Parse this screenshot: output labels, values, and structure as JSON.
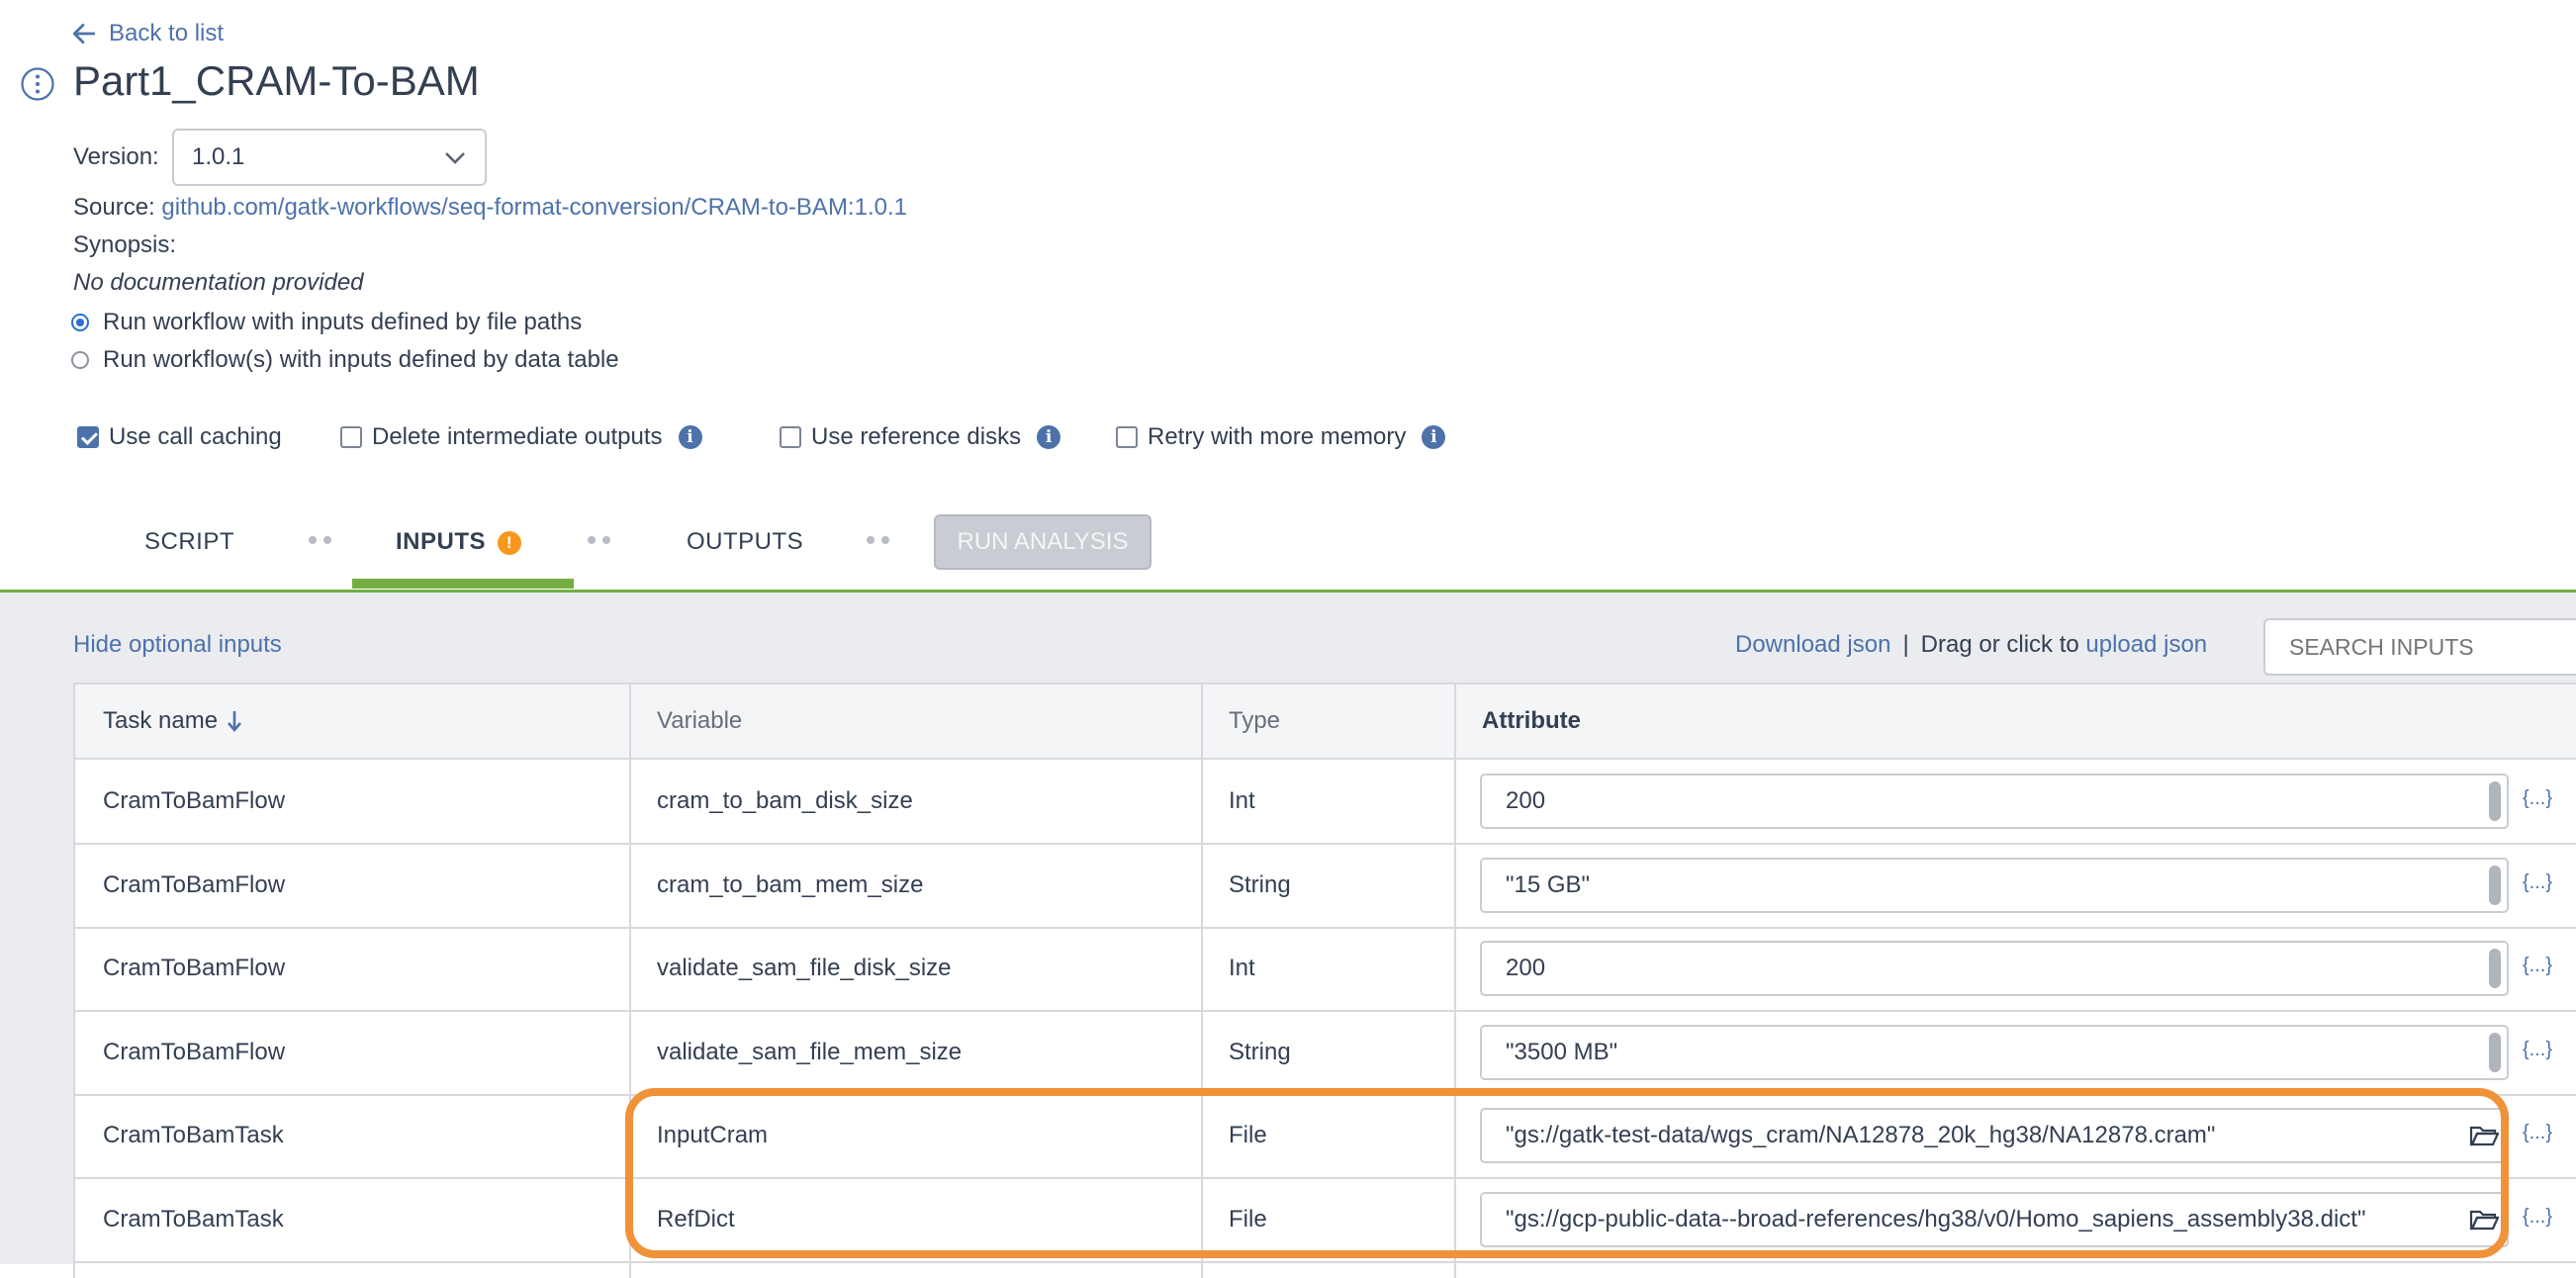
{
  "header": {
    "back_label": "Back to list",
    "title": "Part1_CRAM-To-BAM",
    "version_label": "Version:",
    "version_value": "1.0.1",
    "source_label": "Source:",
    "source_link": "github.com/gatk-workflows/seq-format-conversion/CRAM-to-BAM:1.0.1",
    "synopsis_label": "Synopsis:",
    "no_doc": "No documentation provided"
  },
  "run_mode": {
    "options": [
      {
        "label": "Run workflow with inputs defined by file paths",
        "selected": true
      },
      {
        "label": "Run workflow(s) with inputs defined by data table",
        "selected": false
      }
    ]
  },
  "options": [
    {
      "label": "Use call caching",
      "checked": true,
      "info": false
    },
    {
      "label": "Delete intermediate outputs",
      "checked": false,
      "info": true
    },
    {
      "label": "Use reference disks",
      "checked": false,
      "info": true
    },
    {
      "label": "Retry with more memory",
      "checked": false,
      "info": true
    }
  ],
  "tabs": {
    "script": "SCRIPT",
    "inputs": "INPUTS",
    "outputs": "OUTPUTS",
    "run": "RUN ANALYSIS",
    "active": "INPUTS"
  },
  "inputs_panel": {
    "hide_optional": "Hide optional inputs",
    "download_json": "Download json",
    "separator": "|",
    "drag_text": "Drag or click to",
    "upload_json": "upload json",
    "search_placeholder": "SEARCH INPUTS"
  },
  "table": {
    "headers": {
      "task": "Task name",
      "variable": "Variable",
      "type": "Type",
      "attribute": "Attribute"
    },
    "json_icon": "{...}",
    "rows": [
      {
        "task": "CramToBamFlow",
        "variable": "cram_to_bam_disk_size",
        "type": "Int",
        "attribute": "200",
        "file": false
      },
      {
        "task": "CramToBamFlow",
        "variable": "cram_to_bam_mem_size",
        "type": "String",
        "attribute": "\"15 GB\"",
        "file": false
      },
      {
        "task": "CramToBamFlow",
        "variable": "validate_sam_file_disk_size",
        "type": "Int",
        "attribute": "200",
        "file": false
      },
      {
        "task": "CramToBamFlow",
        "variable": "validate_sam_file_mem_size",
        "type": "String",
        "attribute": "\"3500 MB\"",
        "file": false
      },
      {
        "task": "CramToBamTask",
        "variable": "InputCram",
        "type": "File",
        "attribute": "\"gs://gatk-test-data/wgs_cram/NA12878_20k_hg38/NA12878.cram\"",
        "file": true
      },
      {
        "task": "CramToBamTask",
        "variable": "RefDict",
        "type": "File",
        "attribute": "\"gs://gcp-public-data--broad-references/hg38/v0/Homo_sapiens_assembly38.dict\"",
        "file": true
      }
    ]
  },
  "colors": {
    "accent": "#4d72aa",
    "green": "#74ae43",
    "warning": "#f7981c",
    "highlight": "#f0923a"
  }
}
